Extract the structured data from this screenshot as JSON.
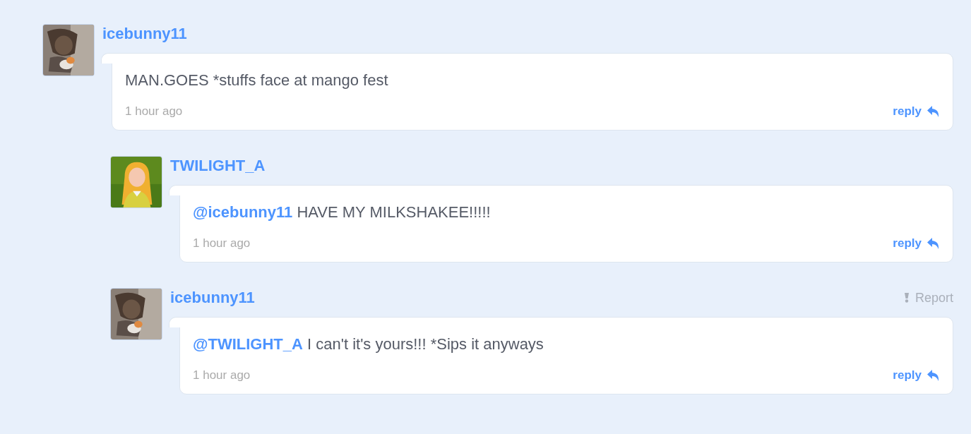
{
  "comments": [
    {
      "author": "icebunny11",
      "body": "MAN.GOES *stuffs face at mango fest",
      "time": "1 hour ago",
      "reply": "reply",
      "children": [
        {
          "author": "TWILIGHT_A",
          "mention": "@icebunny11",
          "body": "HAVE MY MILKSHAKEE!!!!!",
          "time": "1 hour ago",
          "reply": "reply"
        },
        {
          "author": "icebunny11",
          "report": "Report",
          "mention": "@TWILIGHT_A",
          "body": "I can't it's yours!!! *Sips it anyways",
          "time": "1 hour ago",
          "reply": "reply"
        }
      ]
    }
  ]
}
